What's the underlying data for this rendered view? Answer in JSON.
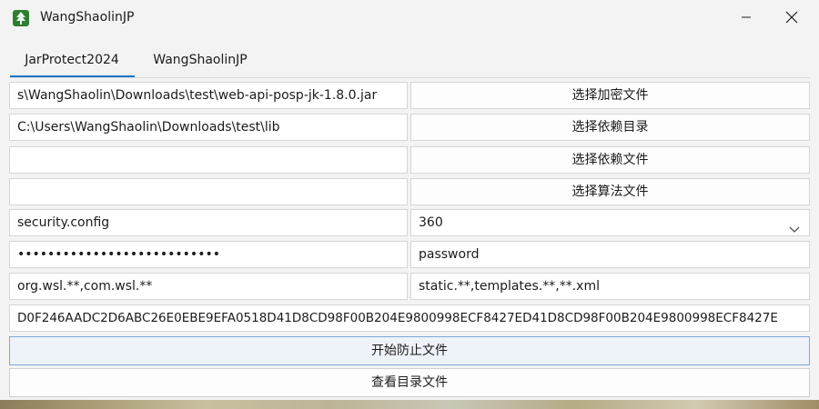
{
  "window": {
    "title": "WangShaolinJP",
    "app_icon": "green-tree-seal-icon",
    "controls": [
      "minimize-icon",
      "close-icon"
    ]
  },
  "tabs": [
    {
      "label": "JarProtect2024",
      "active": true
    },
    {
      "label": "WangShaolinJP",
      "active": false
    }
  ],
  "form": {
    "jar_path": "s\\WangShaolin\\Downloads\\test\\web-api-posp-jk-1.8.0.jar",
    "select_encrypt_file_label": "选择加密文件",
    "lib_dir": "C:\\Users\\WangShaolin\\Downloads\\test\\lib",
    "select_dependency_dir_label": "选择依赖目录",
    "dependency_file": "",
    "select_dependency_file_label": "选择依赖文件",
    "algorithm_file": "",
    "select_algorithm_file_label": "选择算法文件",
    "config_file": "security.config",
    "algorithm_select_value": "360",
    "password_mask": "•••••••••••••••••••••••••••",
    "password_label": "password",
    "include_packages": "org.wsl.**,com.wsl.**",
    "exclude_resources": "static.**,templates.**,**.xml",
    "hash_value": "D0F246AADC2D6ABC26E0EBE9EFA0518D41D8CD98F00B204E9800998ECF8427ED41D8CD98F00B204E9800998ECF8427E"
  },
  "actions": {
    "start_label": "开始防止文件",
    "view_label": "查看目录文件"
  },
  "colors": {
    "accent": "#1e73c8",
    "primary_button_border": "#7ea7d8"
  }
}
